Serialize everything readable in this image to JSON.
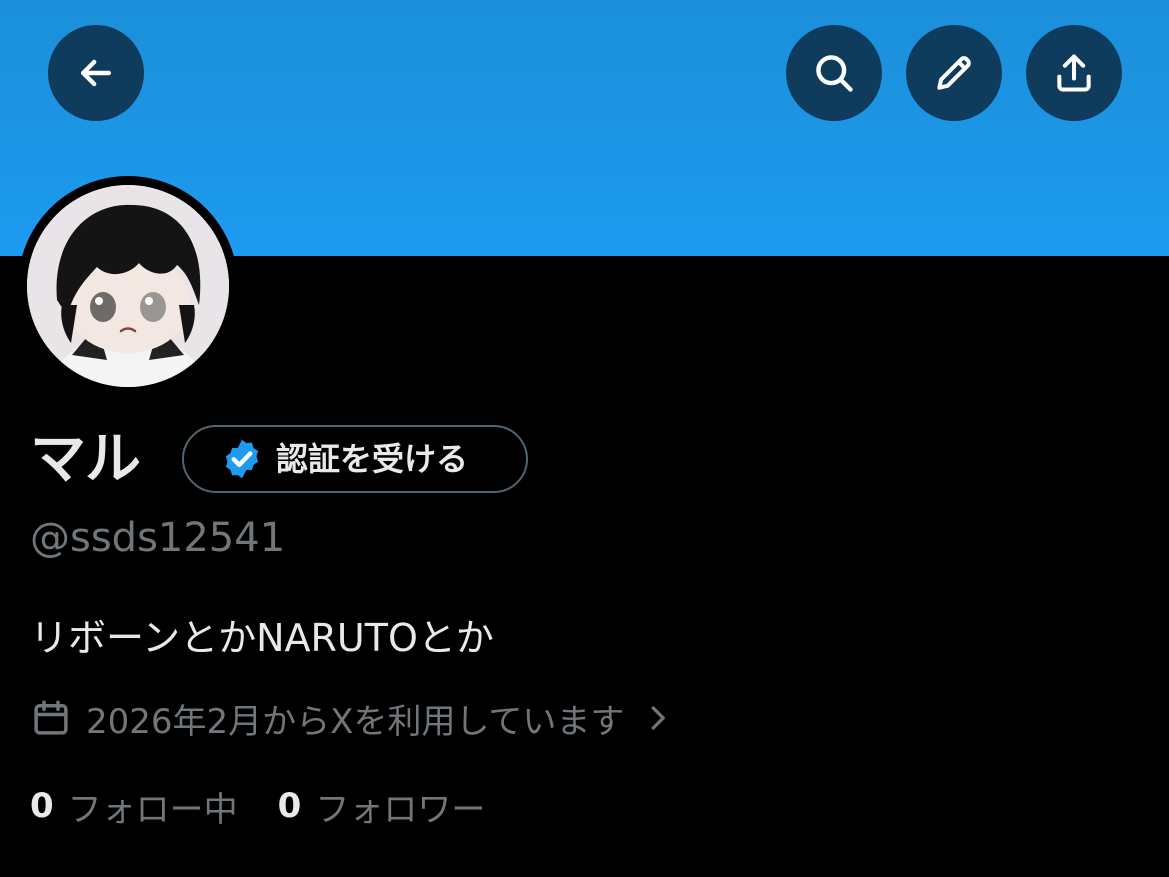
{
  "header": {
    "back_icon": "arrow-left-icon",
    "search_icon": "search-icon",
    "edit_icon": "pencil-icon",
    "share_icon": "share-upload-icon",
    "banner_color": "#1d9bf0",
    "button_bg": "#0f3b5c"
  },
  "profile": {
    "display_name": "マル",
    "verify_button_label": "認証を受ける",
    "verify_icon": "verified-badge-icon",
    "handle": "@ssds12541",
    "bio": "リボーンとかNARUTOとか",
    "joined_icon": "calendar-icon",
    "joined_text": "2026年2月からXを利用しています",
    "joined_chevron_icon": "chevron-right-icon"
  },
  "stats": {
    "following_count": "0",
    "following_label": "フォロー中",
    "followers_count": "0",
    "followers_label": "フォロワー"
  },
  "colors": {
    "accent": "#1d9bf0",
    "text_primary": "#e7e9ea",
    "text_secondary": "#71767b",
    "background": "#000000"
  }
}
